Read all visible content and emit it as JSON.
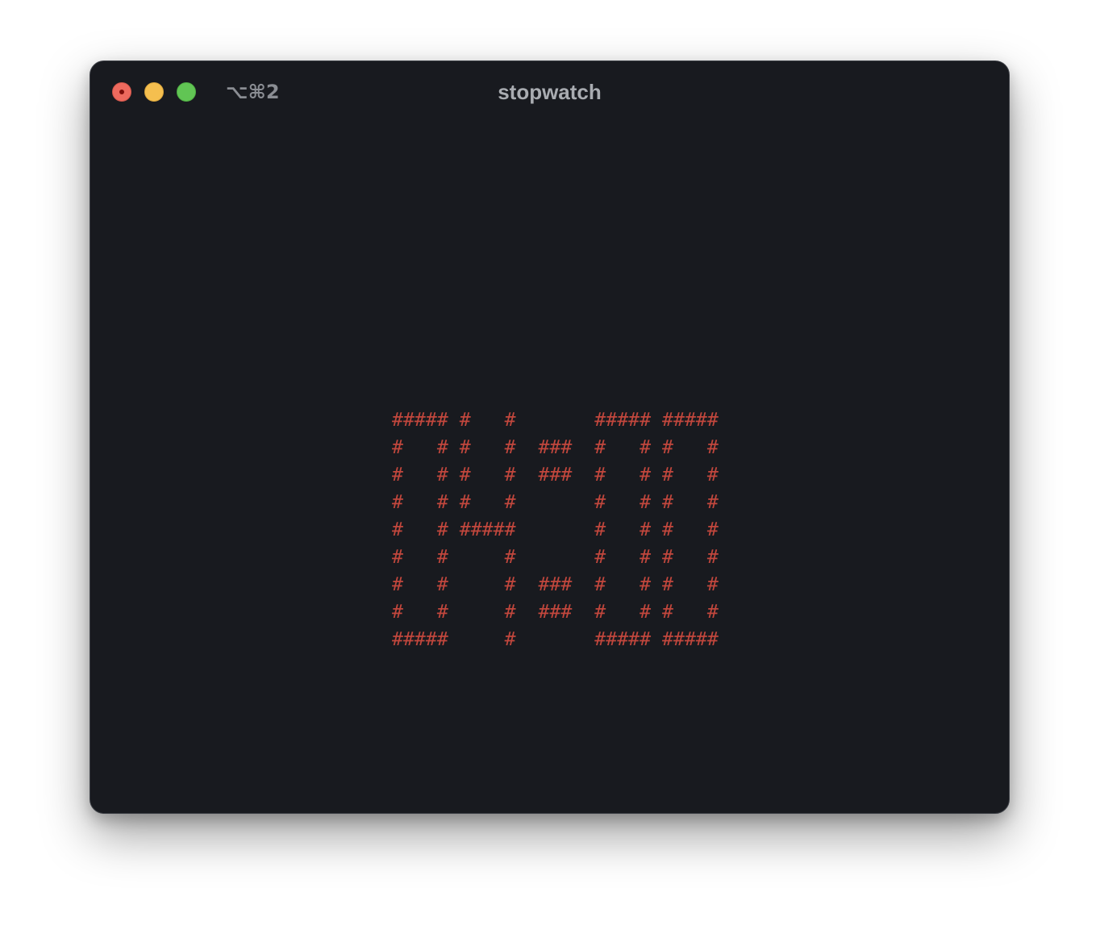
{
  "window": {
    "title": "stopwatch",
    "shortcut": "⌥⌘2"
  },
  "terminal": {
    "clock_ascii": "##### #   #       ##### #####\n#   # #   #  ###  #   # #   #\n#   # #   #  ###  #   # #   #\n#   # #   #       #   # #   #\n#   # #####       #   # #   #\n#   #     #       #   # #   #\n#   #     #  ###  #   # #   #\n#   #     #  ###  #   # #   #\n#####     #       ##### #####",
    "text_color": "#c2473d",
    "background_color": "#181a1f"
  },
  "icons": {
    "close": "close-icon",
    "minimize": "minimize-icon",
    "zoom": "zoom-icon"
  }
}
